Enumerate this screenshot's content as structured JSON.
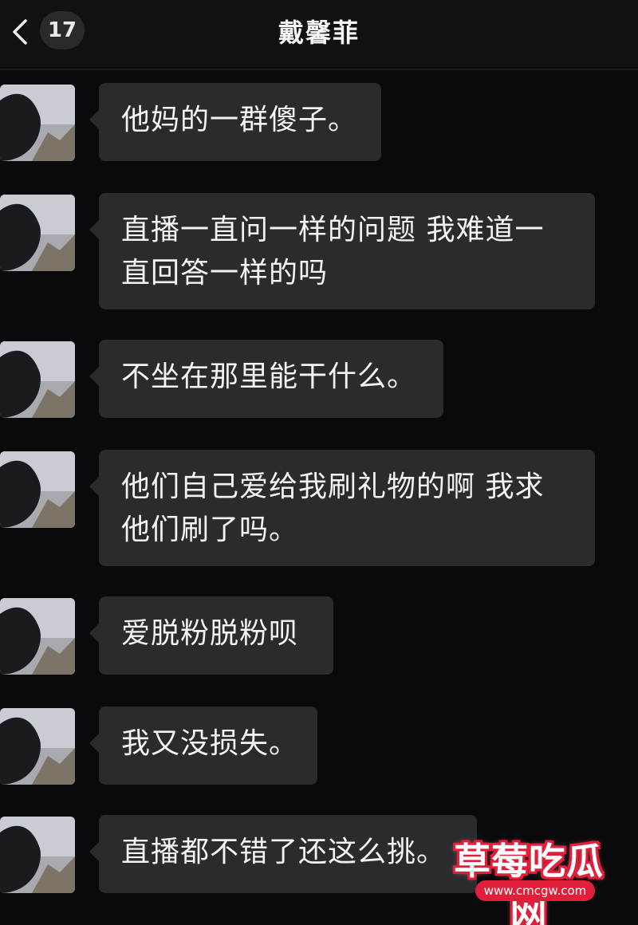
{
  "header": {
    "back_icon": "chevron-left-icon",
    "unread_count": "17",
    "title": "戴馨菲"
  },
  "messages": [
    {
      "lines": [
        "他妈的一群傻子。"
      ]
    },
    {
      "lines": [
        "直播一直问一样的问题 我难道一",
        "直回答一样的吗"
      ]
    },
    {
      "lines": [
        "不坐在那里能干什么。"
      ]
    },
    {
      "lines": [
        "他们自己爱给我刷礼物的啊 我求",
        "他们刷了吗。"
      ]
    },
    {
      "lines": [
        "爱脱粉脱粉呗"
      ]
    },
    {
      "lines": [
        "我又没损失。"
      ]
    },
    {
      "lines": [
        "直播都不错了还这么挑。"
      ]
    }
  ],
  "watermark": {
    "text": "草莓吃瓜网",
    "url": "www.cmcgw.com"
  },
  "colors": {
    "background": "#0a0a0c",
    "bubble": "#2b2b2e",
    "text": "#f3f3f3",
    "watermark": "#e0203a"
  }
}
